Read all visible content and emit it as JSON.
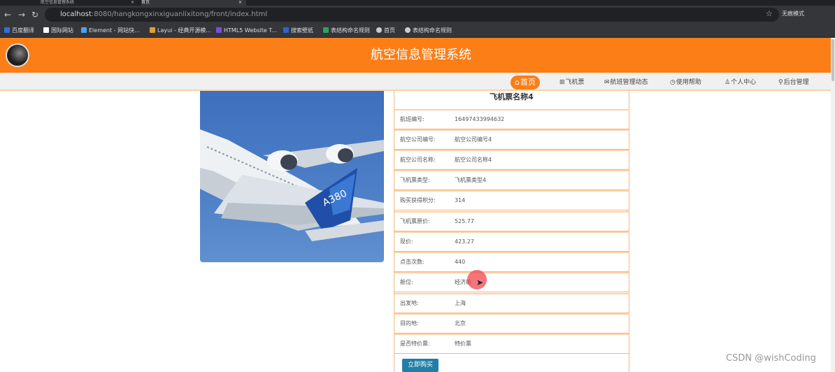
{
  "browser": {
    "tabs": [
      {
        "label": "航空信息管理系统",
        "active": false
      },
      {
        "label": "首页",
        "active": true
      }
    ],
    "url_host": "localhost",
    "url_path": ":8080/hangkongxinxiguanlixitong/front/index.html",
    "profile_label": "无痕模式",
    "bookmarks": [
      {
        "label": "百度翻译",
        "color": "#2f6fde"
      },
      {
        "label": "国际网站",
        "color": "#ffffff"
      },
      {
        "label": "Element - 网站快...",
        "color": "#4aa3f0"
      },
      {
        "label": "Layui - 经典开源模...",
        "color": "#e0a030"
      },
      {
        "label": "HTML5 Website T...",
        "color": "#7a4fd8"
      },
      {
        "label": "搜索壁纸",
        "color": "#2d64c8"
      },
      {
        "label": "表结构命名规则",
        "color": "#2ca35a"
      },
      {
        "label": "首页",
        "color": "#cccccc"
      },
      {
        "label": "表结构命名规则",
        "color": "#cccccc"
      }
    ]
  },
  "site": {
    "title": "航空信息管理系统",
    "nav": [
      {
        "label": "首页",
        "icon": "home-icon",
        "glyph": "⌂",
        "active": true
      },
      {
        "label": "飞机票",
        "icon": "grid-icon",
        "glyph": "⊞",
        "active": false
      },
      {
        "label": "航班管理动态",
        "icon": "message-icon",
        "glyph": "✉",
        "active": false
      },
      {
        "label": "使用帮助",
        "icon": "tag-icon",
        "glyph": "◷",
        "active": false
      },
      {
        "label": "个人中心",
        "icon": "user-icon",
        "glyph": "♙",
        "active": false
      },
      {
        "label": "后台管理",
        "icon": "link-icon",
        "glyph": "⚲",
        "active": false
      }
    ]
  },
  "detail": {
    "title": "飞机票名称4",
    "rows": [
      {
        "label": "航班编号:",
        "value": "16497433994632"
      },
      {
        "label": "航空公司编号:",
        "value": "航空公司编号4"
      },
      {
        "label": "航空公司名称:",
        "value": "航空公司名称4"
      },
      {
        "label": "飞机票类型:",
        "value": "飞机票类型4"
      },
      {
        "label": "购买获得积分:",
        "value": "314"
      },
      {
        "label": "飞机票原价:",
        "value": "525.77"
      },
      {
        "label": "现价:",
        "value": "423.27"
      },
      {
        "label": "点击次数:",
        "value": "440"
      },
      {
        "label": "舱位:",
        "value": "经济舱"
      },
      {
        "label": "出发地:",
        "value": "上海"
      },
      {
        "label": "目的地:",
        "value": "北京"
      },
      {
        "label": "是否特价票:",
        "value": "特价票"
      }
    ],
    "buy_label": "立即购买"
  },
  "aircraft_livery_text": "A380",
  "watermark": "CSDN @wishCoding",
  "colors": {
    "header_orange": "#fb7e17",
    "buy_button": "#1e7fa8",
    "row_border": "#f5b780"
  }
}
